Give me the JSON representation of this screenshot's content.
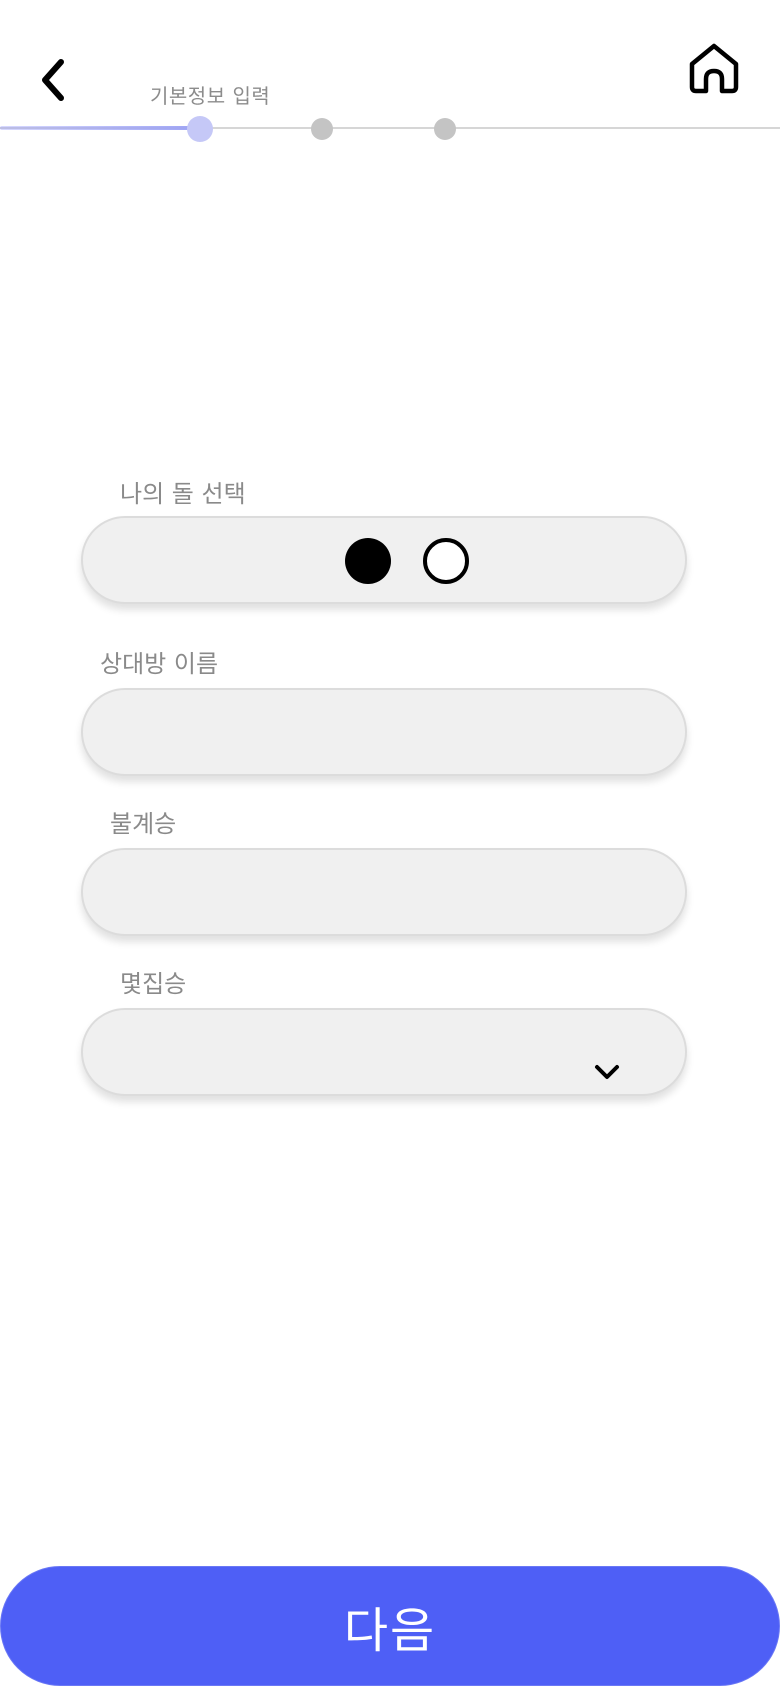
{
  "header": {
    "back_icon": "chevron-left-icon",
    "home_icon": "home-icon"
  },
  "progress": {
    "label": "기본정보 입력",
    "current_step": 1,
    "total_steps": 3,
    "active_color": "#c5c8f7",
    "inactive_color": "#c4c4c4"
  },
  "form": {
    "stone_select": {
      "label": "나의 돌 선택",
      "options": [
        "black-stone",
        "white-stone"
      ]
    },
    "opponent_name": {
      "label": "상대방 이름",
      "value": ""
    },
    "bulgyeseung": {
      "label": "불계승",
      "value": ""
    },
    "myeotjipseung": {
      "label": "몇집승",
      "selected": "",
      "icon": "chevron-down-icon"
    }
  },
  "footer": {
    "next_label": "다음",
    "accent_color": "#4e5ff6"
  }
}
